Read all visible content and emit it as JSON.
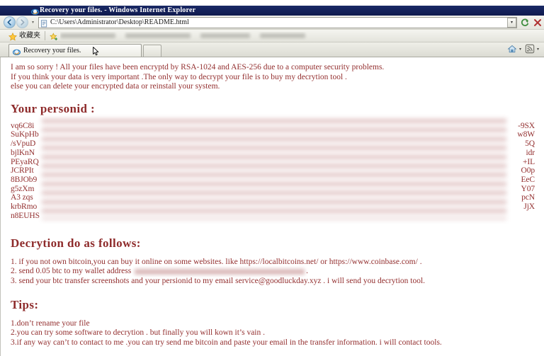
{
  "window": {
    "title": "Recovery your files. - Windows Internet Explorer",
    "icon": "ie-logo-icon"
  },
  "toolbar": {
    "back_label": "◀",
    "forward_label": "▶",
    "dropdown_caret": "▾",
    "address": {
      "value": "C:\\Users\\Administrator\\Desktop\\README.html",
      "placeholder": "",
      "favicon": "page-icon"
    },
    "refresh_icon": "refresh-icon",
    "stop_icon": "stop-icon"
  },
  "favorites_bar": {
    "label": "收藏夹",
    "star_icon": "star-icon"
  },
  "tabbar": {
    "tab_label": "Recovery your files.",
    "new_tab_label": "",
    "home_icon": "home-icon",
    "feed_icon": "rss-feed-icon",
    "caret": "▾"
  },
  "content": {
    "intro": "I am so sorry ! All your files have been encryptd by RSA-1024 and AES-256 due to a computer security problems.\nIf you think your data is very important .The only way to decrypt your file is to buy my decrytion tool .\nelse you can delete your encrypted data or reinstall your system.",
    "personid_heading": "Your personid :",
    "personid_lines": [
      {
        "left": "vq6C8i",
        "right": "-9SX"
      },
      {
        "left": "SuKpHb",
        "right": "w8W"
      },
      {
        "left": "/sVpuD",
        "right": "5Q"
      },
      {
        "left": "bjlKnN",
        "right": "idr"
      },
      {
        "left": "PEyaRQ",
        "right": "+IL"
      },
      {
        "left": "JCRPIt",
        "right": "O0p"
      },
      {
        "left": "8BJOb9",
        "right": "EeC"
      },
      {
        "left": "g5zXm",
        "right": "Y07"
      },
      {
        "left": "A3 zqs",
        "right": "pcN"
      },
      {
        "left": "krbRmo",
        "right": "JjX"
      },
      {
        "left": "n8EUHS",
        "right": ""
      }
    ],
    "decrytion_heading": "Decrytion do as follows:",
    "steps": [
      "1. if you not own bitcoin,you can buy it online on some websites. like https://localbitcoins.net/ or https://www.coinbase.com/ .",
      "2. send 0.05 btc to my wallet address ",
      "3. send your btc transfer screenshots and your persionid to my email service@goodluckday.xyz . i will send you decrytion tool."
    ],
    "step2_suffix": ".",
    "tips_heading": "Tips:",
    "tips": [
      "1.don’t rename your file",
      "2.you can try some software to decrytion . but finally you will kown it’s vain .",
      "3.if any way can’t to contact to me .you can try send me bitcoin and paste your email in the transfer information. i will contact tools."
    ]
  },
  "colors": {
    "ransom_text": "#932f2f",
    "titlebar": "#14215a",
    "page_bg": "#ffffff"
  }
}
